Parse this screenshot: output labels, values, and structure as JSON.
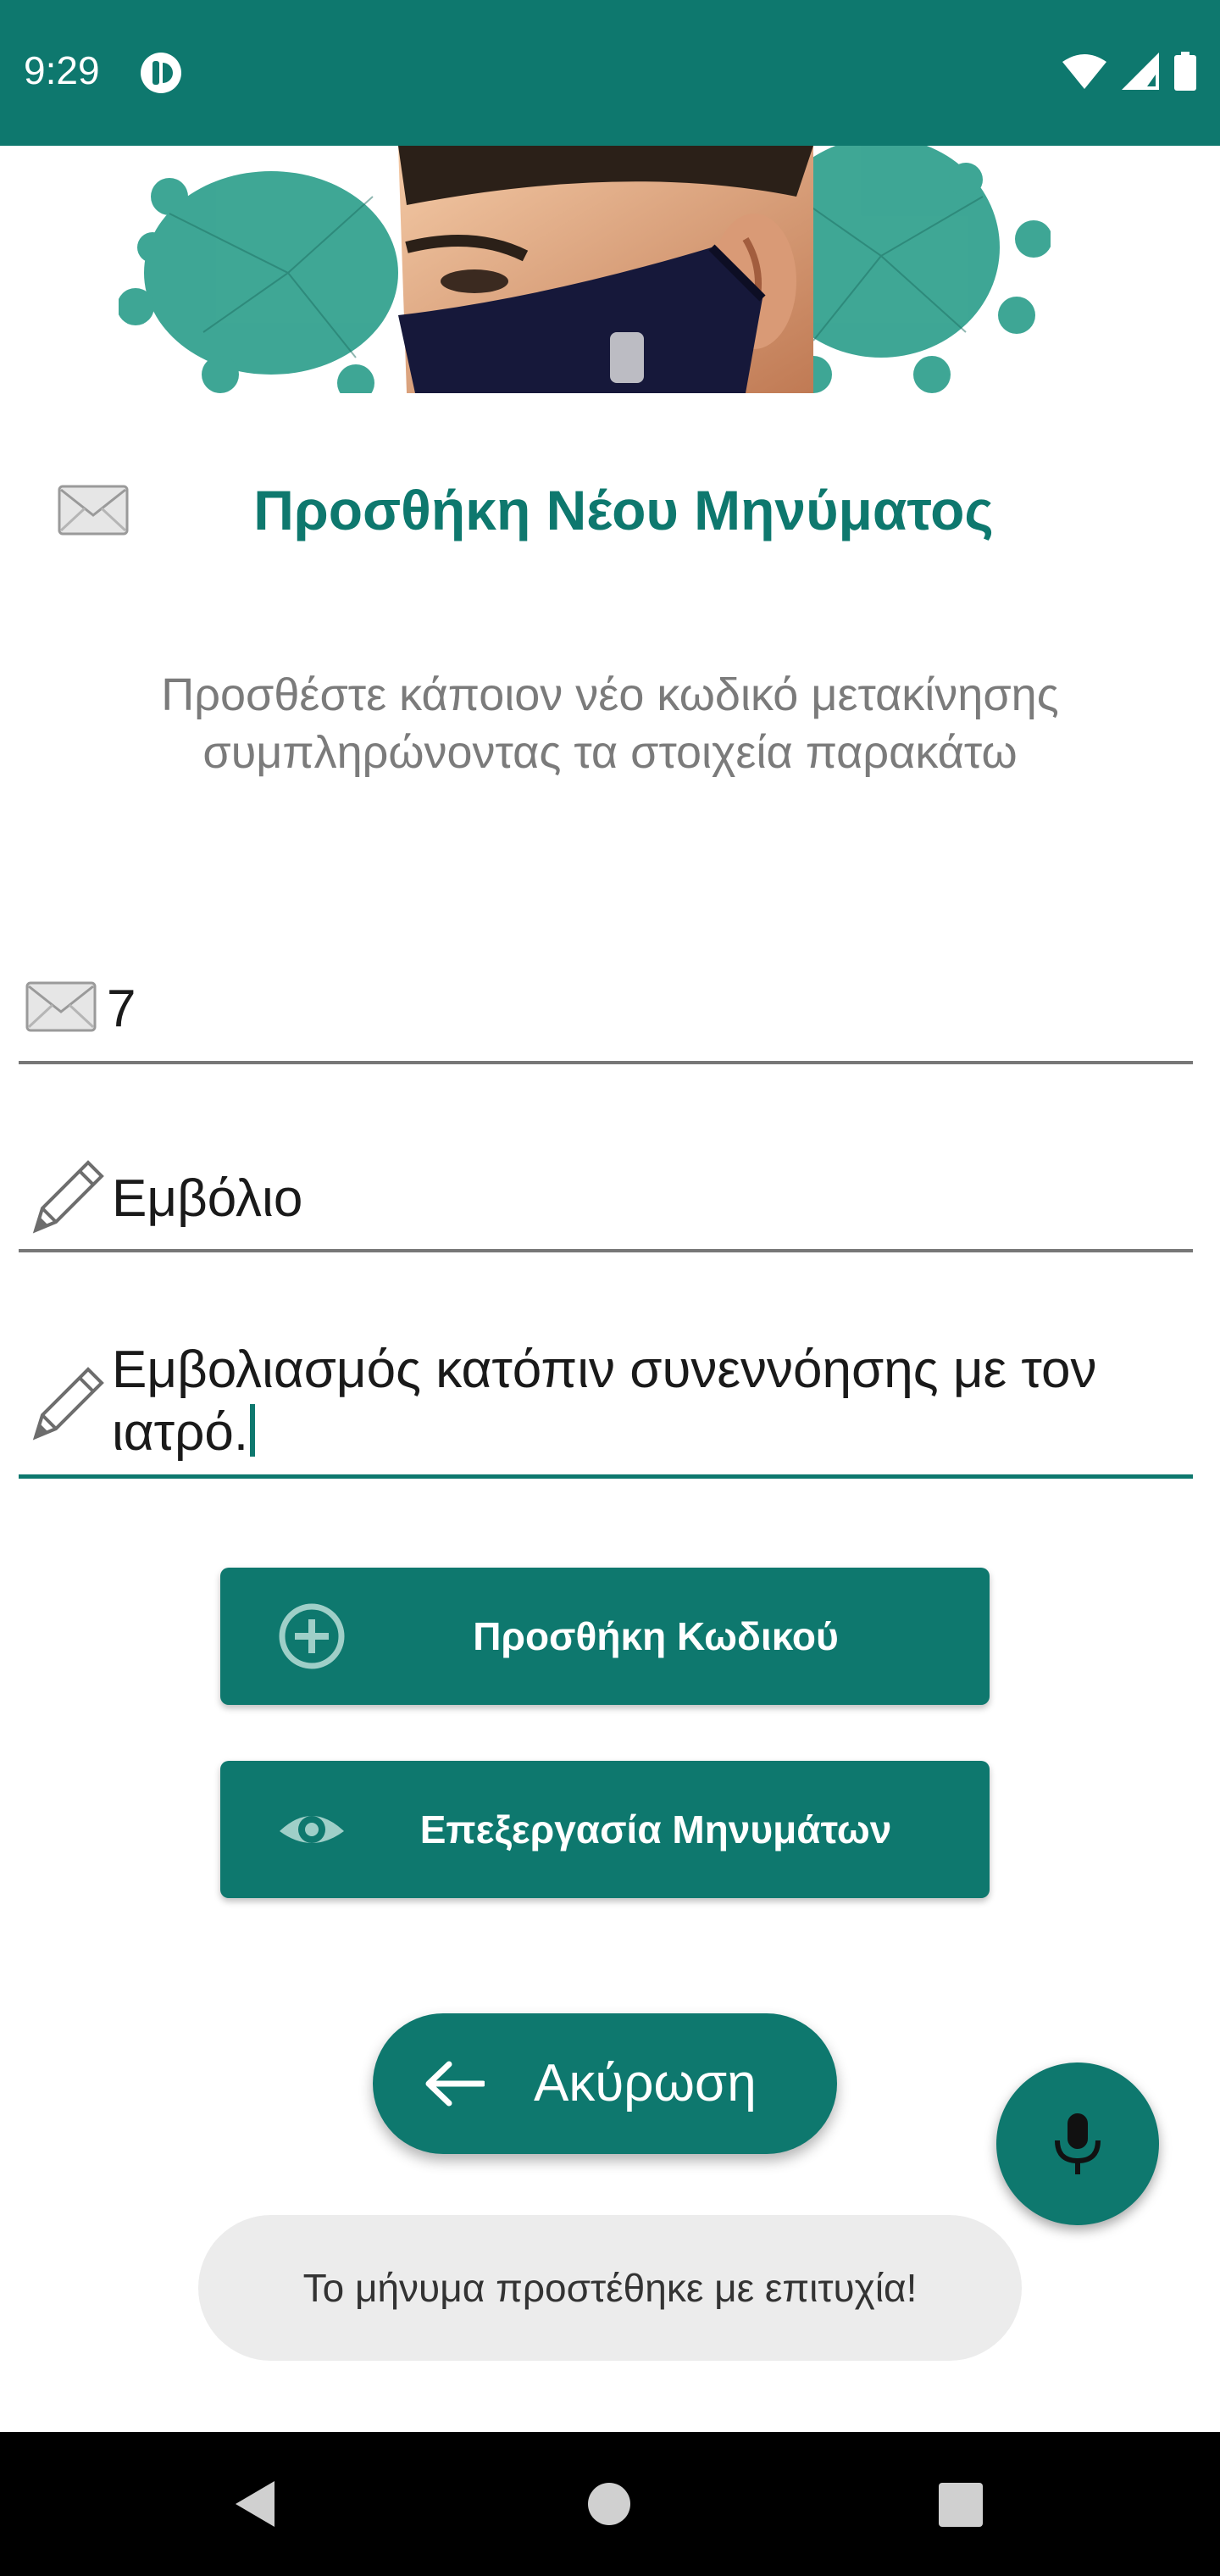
{
  "status_bar": {
    "time": "9:29",
    "app_icon": "app-notification-icon",
    "icons": [
      "wifi-icon",
      "signal-icon",
      "battery-icon"
    ]
  },
  "header": {
    "title": "Προσθήκη Νέου Μηνύματος",
    "title_icon": "envelope-icon",
    "subtitle": "Προσθέστε κάποιον νέο κωδικό μετακίνησης\nσυμπληρώνοντας τα στοιχεία παρακάτω"
  },
  "form": {
    "code": {
      "icon": "envelope-icon",
      "value": "7"
    },
    "title": {
      "icon": "pencil-icon",
      "value": "Εμβόλιο"
    },
    "description": {
      "icon": "pencil-icon",
      "value": "Εμβολιασμός κατόπιν συνεννόησης με τον ιατρό."
    }
  },
  "buttons": {
    "add_code": {
      "label": "Προσθήκη Κωδικού",
      "icon": "plus-circle-icon"
    },
    "edit_messages": {
      "label": "Επεξεργασία Μηνυμάτων",
      "icon": "eye-icon"
    },
    "cancel": {
      "label": "Ακύρωση",
      "icon": "arrow-left-icon"
    },
    "mic": {
      "icon": "microphone-icon"
    }
  },
  "toast": {
    "text": "Το μήνυμα προστέθηκε με επιτυχία!"
  },
  "colors": {
    "primary": "#0e786e",
    "toast_bg": "#ececec",
    "subtitle": "#7b7b7b"
  },
  "nav_bar": {
    "icons": [
      "back-icon",
      "home-icon",
      "recents-icon"
    ]
  }
}
